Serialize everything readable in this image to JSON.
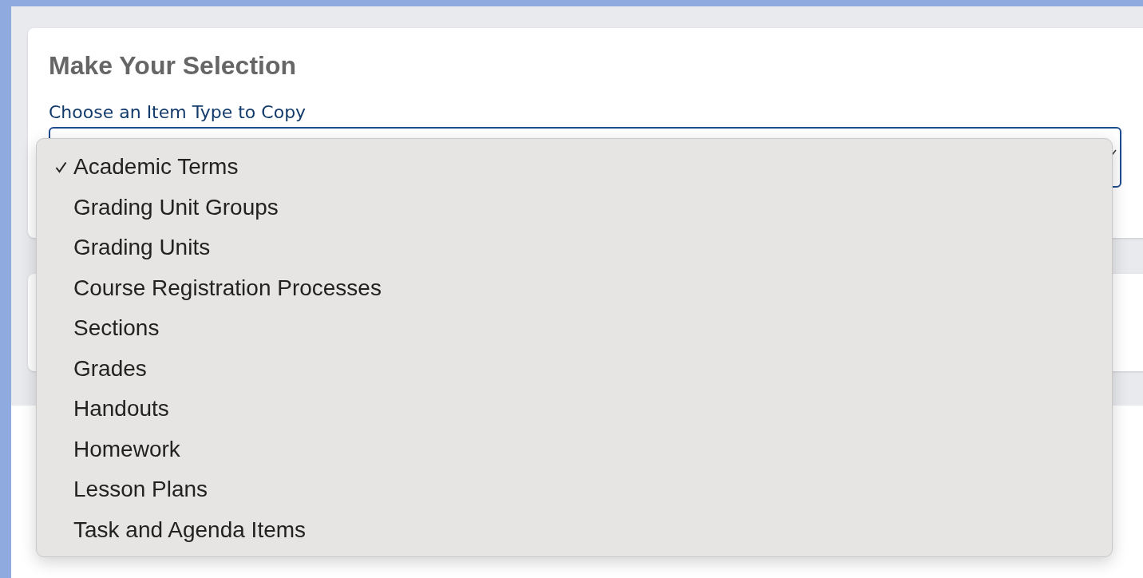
{
  "card": {
    "title": "Make Your Selection",
    "field_label": "Choose an Item Type to Copy"
  },
  "dropdown": {
    "options": [
      {
        "label": "Academic Terms",
        "selected": true
      },
      {
        "label": "Grading Unit Groups",
        "selected": false
      },
      {
        "label": "Grading Units",
        "selected": false
      },
      {
        "label": "Course Registration Processes",
        "selected": false
      },
      {
        "label": "Sections",
        "selected": false
      },
      {
        "label": "Grades",
        "selected": false
      },
      {
        "label": "Handouts",
        "selected": false
      },
      {
        "label": "Homework",
        "selected": false
      },
      {
        "label": "Lesson Plans",
        "selected": false
      },
      {
        "label": "Task and Agenda Items",
        "selected": false
      }
    ]
  }
}
